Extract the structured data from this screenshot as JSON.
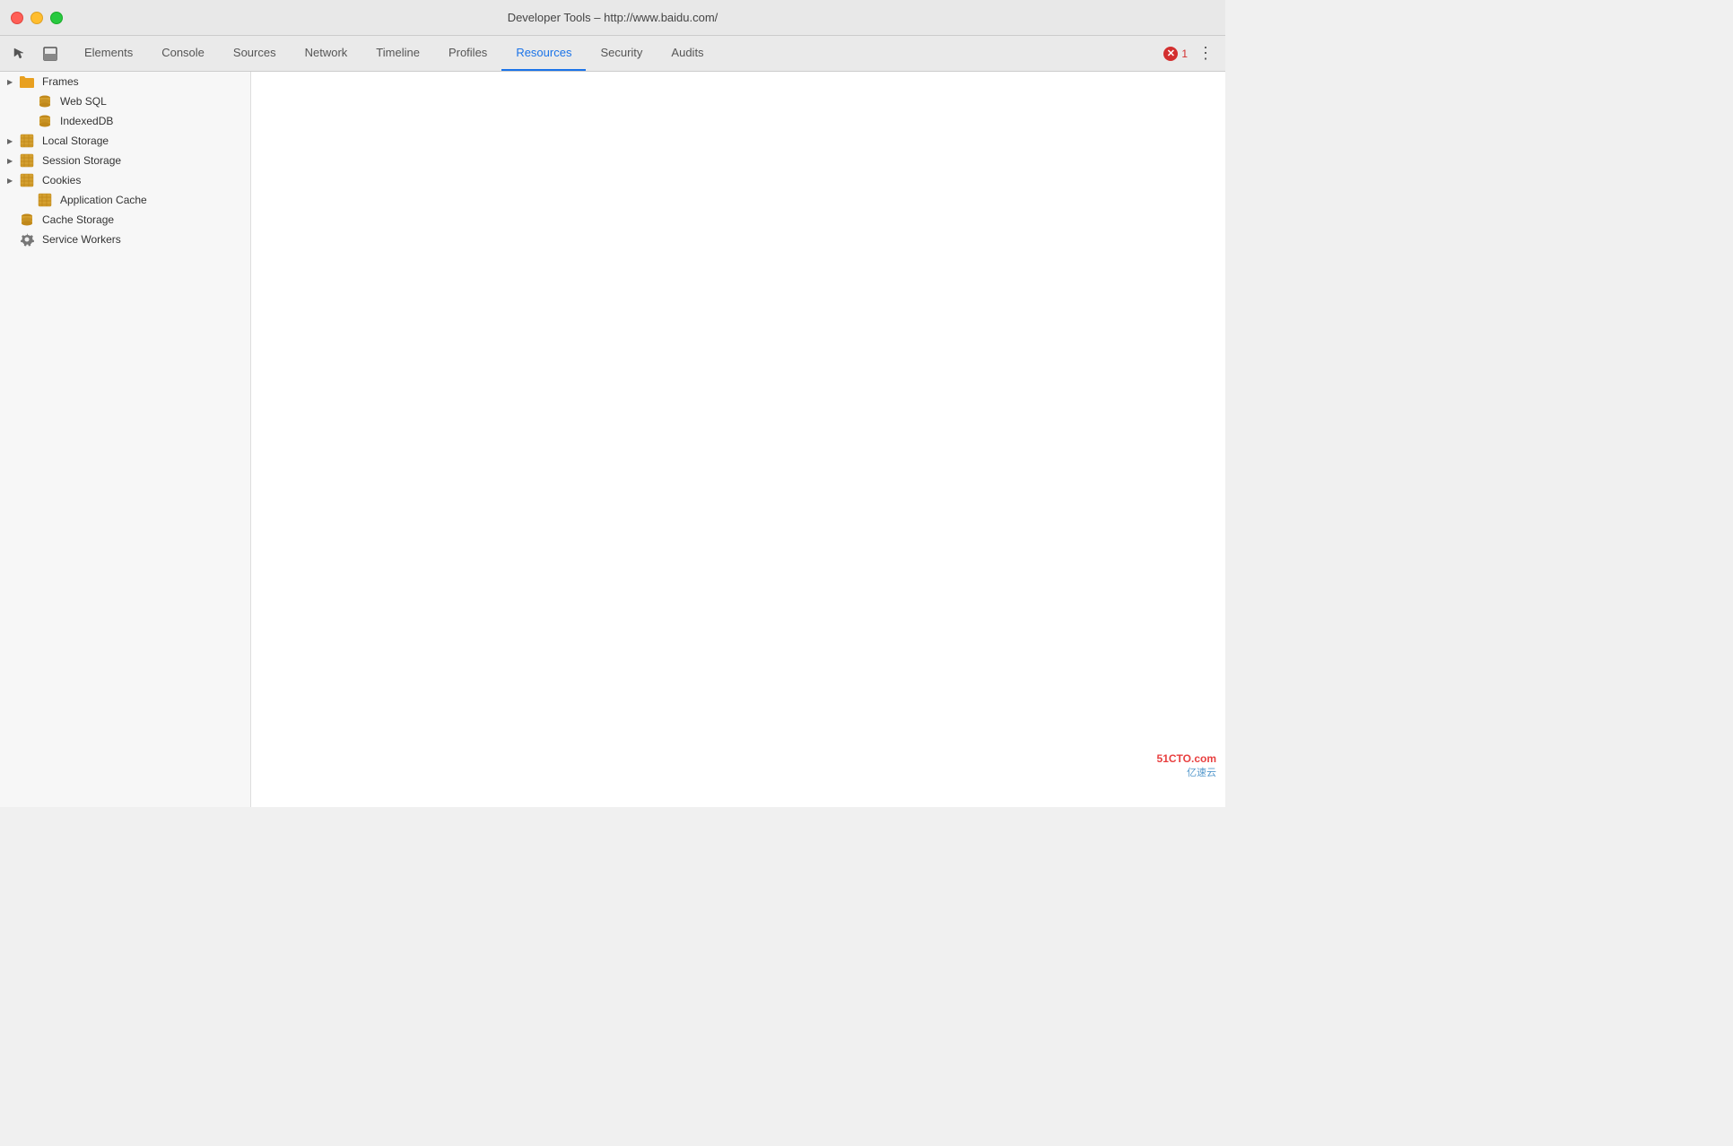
{
  "titleBar": {
    "title": "Developer Tools – http://www.baidu.com/"
  },
  "trafficLights": {
    "close": "close",
    "minimize": "minimize",
    "maximize": "maximize"
  },
  "toolbar": {
    "inspectIcon": "☰",
    "dockIcon": "⊡",
    "tabs": [
      {
        "id": "elements",
        "label": "Elements",
        "active": false
      },
      {
        "id": "console",
        "label": "Console",
        "active": false
      },
      {
        "id": "sources",
        "label": "Sources",
        "active": false
      },
      {
        "id": "network",
        "label": "Network",
        "active": false
      },
      {
        "id": "timeline",
        "label": "Timeline",
        "active": false
      },
      {
        "id": "profiles",
        "label": "Profiles",
        "active": false
      },
      {
        "id": "resources",
        "label": "Resources",
        "active": true
      },
      {
        "id": "security",
        "label": "Security",
        "active": false
      },
      {
        "id": "audits",
        "label": "Audits",
        "active": false
      }
    ],
    "errorCount": "1",
    "moreIcon": "⋮"
  },
  "sidebar": {
    "items": [
      {
        "id": "frames",
        "label": "Frames",
        "icon": "folder",
        "level": 0,
        "expandable": true
      },
      {
        "id": "web-sql",
        "label": "Web SQL",
        "icon": "db-gold",
        "level": 1,
        "expandable": false
      },
      {
        "id": "indexeddb",
        "label": "IndexedDB",
        "icon": "db-gold",
        "level": 1,
        "expandable": false
      },
      {
        "id": "local-storage",
        "label": "Local Storage",
        "icon": "grid-gold",
        "level": 0,
        "expandable": true
      },
      {
        "id": "session-storage",
        "label": "Session Storage",
        "icon": "grid-gold",
        "level": 0,
        "expandable": true
      },
      {
        "id": "cookies",
        "label": "Cookies",
        "icon": "grid-gold",
        "level": 0,
        "expandable": true
      },
      {
        "id": "application-cache",
        "label": "Application Cache",
        "icon": "grid-gold",
        "level": 1,
        "expandable": false
      },
      {
        "id": "cache-storage",
        "label": "Cache Storage",
        "icon": "db-gold",
        "level": 0,
        "expandable": false
      },
      {
        "id": "service-workers",
        "label": "Service Workers",
        "icon": "gear",
        "level": 0,
        "expandable": false
      }
    ]
  },
  "watermark": {
    "site": "51CTO.com",
    "sub": "亿速云"
  }
}
